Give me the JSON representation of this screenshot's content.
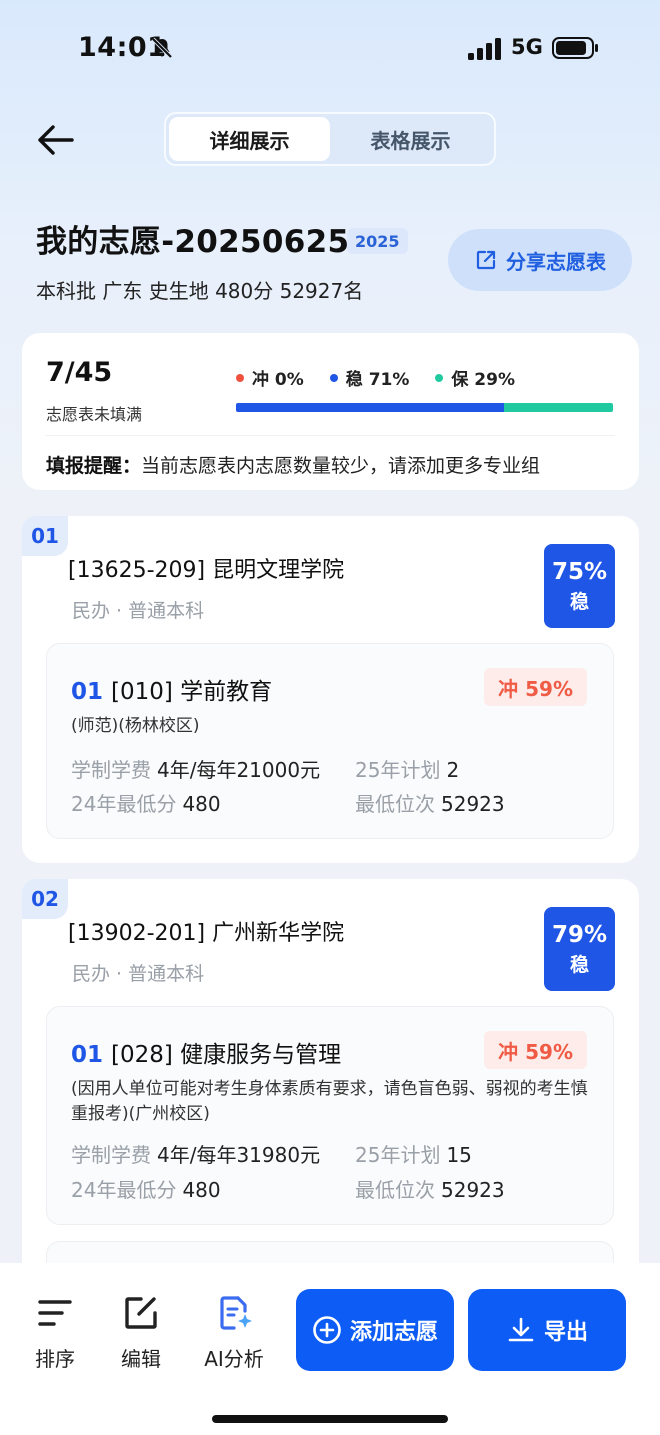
{
  "status": {
    "time": "14:01",
    "network": "5G"
  },
  "tabs": {
    "detail": "详细展示",
    "table": "表格展示"
  },
  "plan": {
    "title": "我的志愿-20250625",
    "year": "2025",
    "subtitle": "本科批 广东 史生地 480分 52927名",
    "share_label": "分享志愿表"
  },
  "summary": {
    "count": "7/45",
    "note": "志愿表未填满",
    "legend": [
      {
        "label": "冲 0%",
        "color": "#f0513c",
        "fraction": 0.0
      },
      {
        "label": "稳 71%",
        "color": "#1f56e6",
        "fraction": 0.71
      },
      {
        "label": "保 29%",
        "color": "#20c9a0",
        "fraction": 0.29
      }
    ],
    "reminder_label": "填报提醒：",
    "reminder_text": "当前志愿表内志愿数量较少，请添加更多专业组"
  },
  "cards": [
    {
      "index": "01",
      "school": "[13625-209] 昆明文理学院",
      "meta": "民办 · 普通本科",
      "prob_pct": "75%",
      "prob_label": "稳",
      "major": {
        "index": "01",
        "name": "[010] 学前教育",
        "chance": "冲 59%",
        "remark": "(师范)(杨林校区)",
        "fee_label": "学制学费",
        "fee_value": "4年/每年21000元",
        "plan_label": "25年计划",
        "plan_value": "2",
        "min_score_label": "24年最低分",
        "min_score_value": "480",
        "min_rank_label": "最低位次",
        "min_rank_value": "52923"
      }
    },
    {
      "index": "02",
      "school": "[13902-201] 广州新华学院",
      "meta": "民办 · 普通本科",
      "prob_pct": "79%",
      "prob_label": "稳",
      "major": {
        "index": "01",
        "name": "[028] 健康服务与管理",
        "chance": "冲 59%",
        "remark": "(因用人单位可能对考生身体素质有要求，请色盲色弱、弱视的考生慎重报考)(广州校区)",
        "fee_label": "学制学费",
        "fee_value": "4年/每年31980元",
        "plan_label": "25年计划",
        "plan_value": "15",
        "min_score_label": "24年最低分",
        "min_score_value": "480",
        "min_rank_label": "最低位次",
        "min_rank_value": "52923"
      }
    }
  ],
  "bottom": {
    "sort": "排序",
    "edit": "编辑",
    "ai": "AI分析",
    "add": "添加志愿",
    "export": "导出"
  }
}
